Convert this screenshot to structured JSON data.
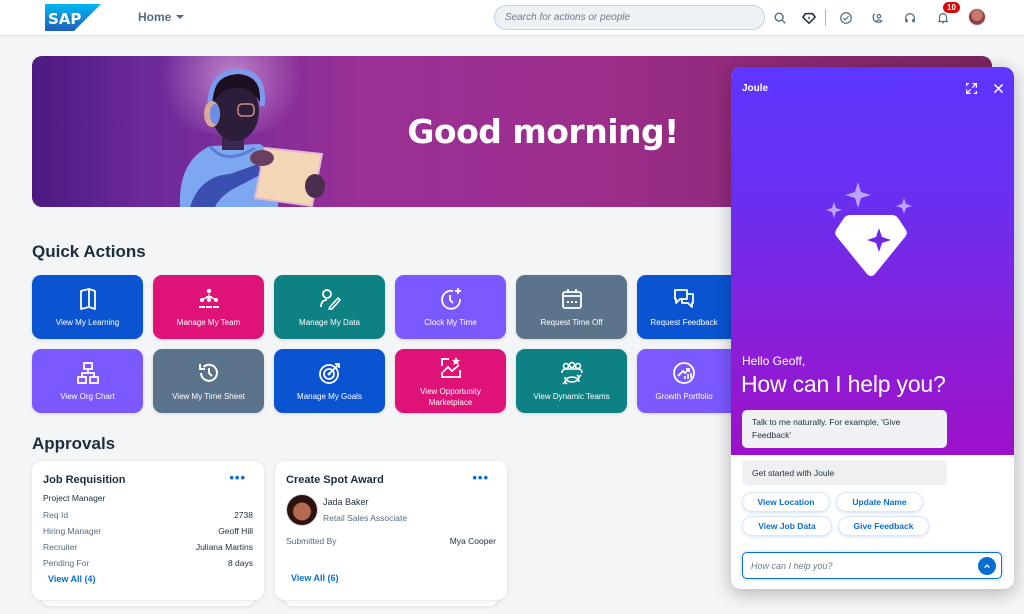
{
  "header": {
    "logo": "SAP",
    "home_menu": "Home",
    "search_placeholder": "Search for actions or people",
    "notification_count": "10",
    "icons": [
      "search-icon",
      "joule-diamond-icon",
      "check-circle-icon",
      "person-chat-icon",
      "headset-icon",
      "bell-icon",
      "user-avatar"
    ]
  },
  "banner": {
    "greeting": "Good morning!"
  },
  "quick_actions": {
    "title": "Quick Actions",
    "tiles": [
      {
        "label": "View My Learning",
        "icon": "book-icon",
        "color": "#0a54d2"
      },
      {
        "label": "Manage My Team",
        "icon": "team-hierarchy-icon",
        "color": "#df1277"
      },
      {
        "label": "Manage My Data",
        "icon": "person-edit-icon",
        "color": "#0d8184"
      },
      {
        "label": "Clock My Time",
        "icon": "clock-add-icon",
        "color": "#7b58ff"
      },
      {
        "label": "Request Time Off",
        "icon": "calendar-icon",
        "color": "#5b738b"
      },
      {
        "label": "Request Feedback",
        "icon": "feedback-icon",
        "color": "#0a54d2"
      },
      {
        "label": "View Org Chart",
        "icon": "org-chart-icon",
        "color": "#7b58ff"
      },
      {
        "label": "View My Time Sheet",
        "icon": "history-icon",
        "color": "#5b738b"
      },
      {
        "label": "Manage My Goals",
        "icon": "target-icon",
        "color": "#0a54d2"
      },
      {
        "label": "View Opportunity Marketplace",
        "icon": "opportunity-chart-icon",
        "color": "#df1277"
      },
      {
        "label": "View Dynamic Teams",
        "icon": "dynamic-team-icon",
        "color": "#0d8184"
      },
      {
        "label": "Growth Portfolio",
        "icon": "growth-icon",
        "color": "#7b58ff"
      }
    ]
  },
  "approvals": {
    "title": "Approvals",
    "job_requisition": {
      "title": "Job Requisition",
      "subtitle": "Project Manager",
      "rows": [
        {
          "key": "Req Id",
          "value": "2738"
        },
        {
          "key": "Hiring Manager",
          "value": "Geoff Hill"
        },
        {
          "key": "Recruiter",
          "value": "Juliana Martins"
        },
        {
          "key": "Pending For",
          "value": "8 days"
        }
      ],
      "view_all": "View All (4)"
    },
    "spot_award": {
      "title": "Create Spot Award",
      "person_name": "Jada Baker",
      "person_role": "Retail Sales Associate",
      "submitted_by_label": "Submitted By",
      "submitted_by_value": "Mya Cooper",
      "view_all": "View All (6)"
    },
    "more_label": "•••"
  },
  "joule": {
    "title": "Joule",
    "hello": "Hello Geoff,",
    "question": "How can I help  you?",
    "hint": "Talk to me naturally. For example, 'Give Feedback'",
    "get_started": "Get started with Joule",
    "chips": [
      "View Location",
      "Update Name",
      "View Job Data",
      "Give Feedback"
    ],
    "input_placeholder": "How can I help you?"
  },
  "colors": {
    "accent": "#0a6ed1",
    "joule_top": "#5d36ff",
    "joule_bottom": "#9c11c9",
    "badge": "#d20a0a"
  }
}
